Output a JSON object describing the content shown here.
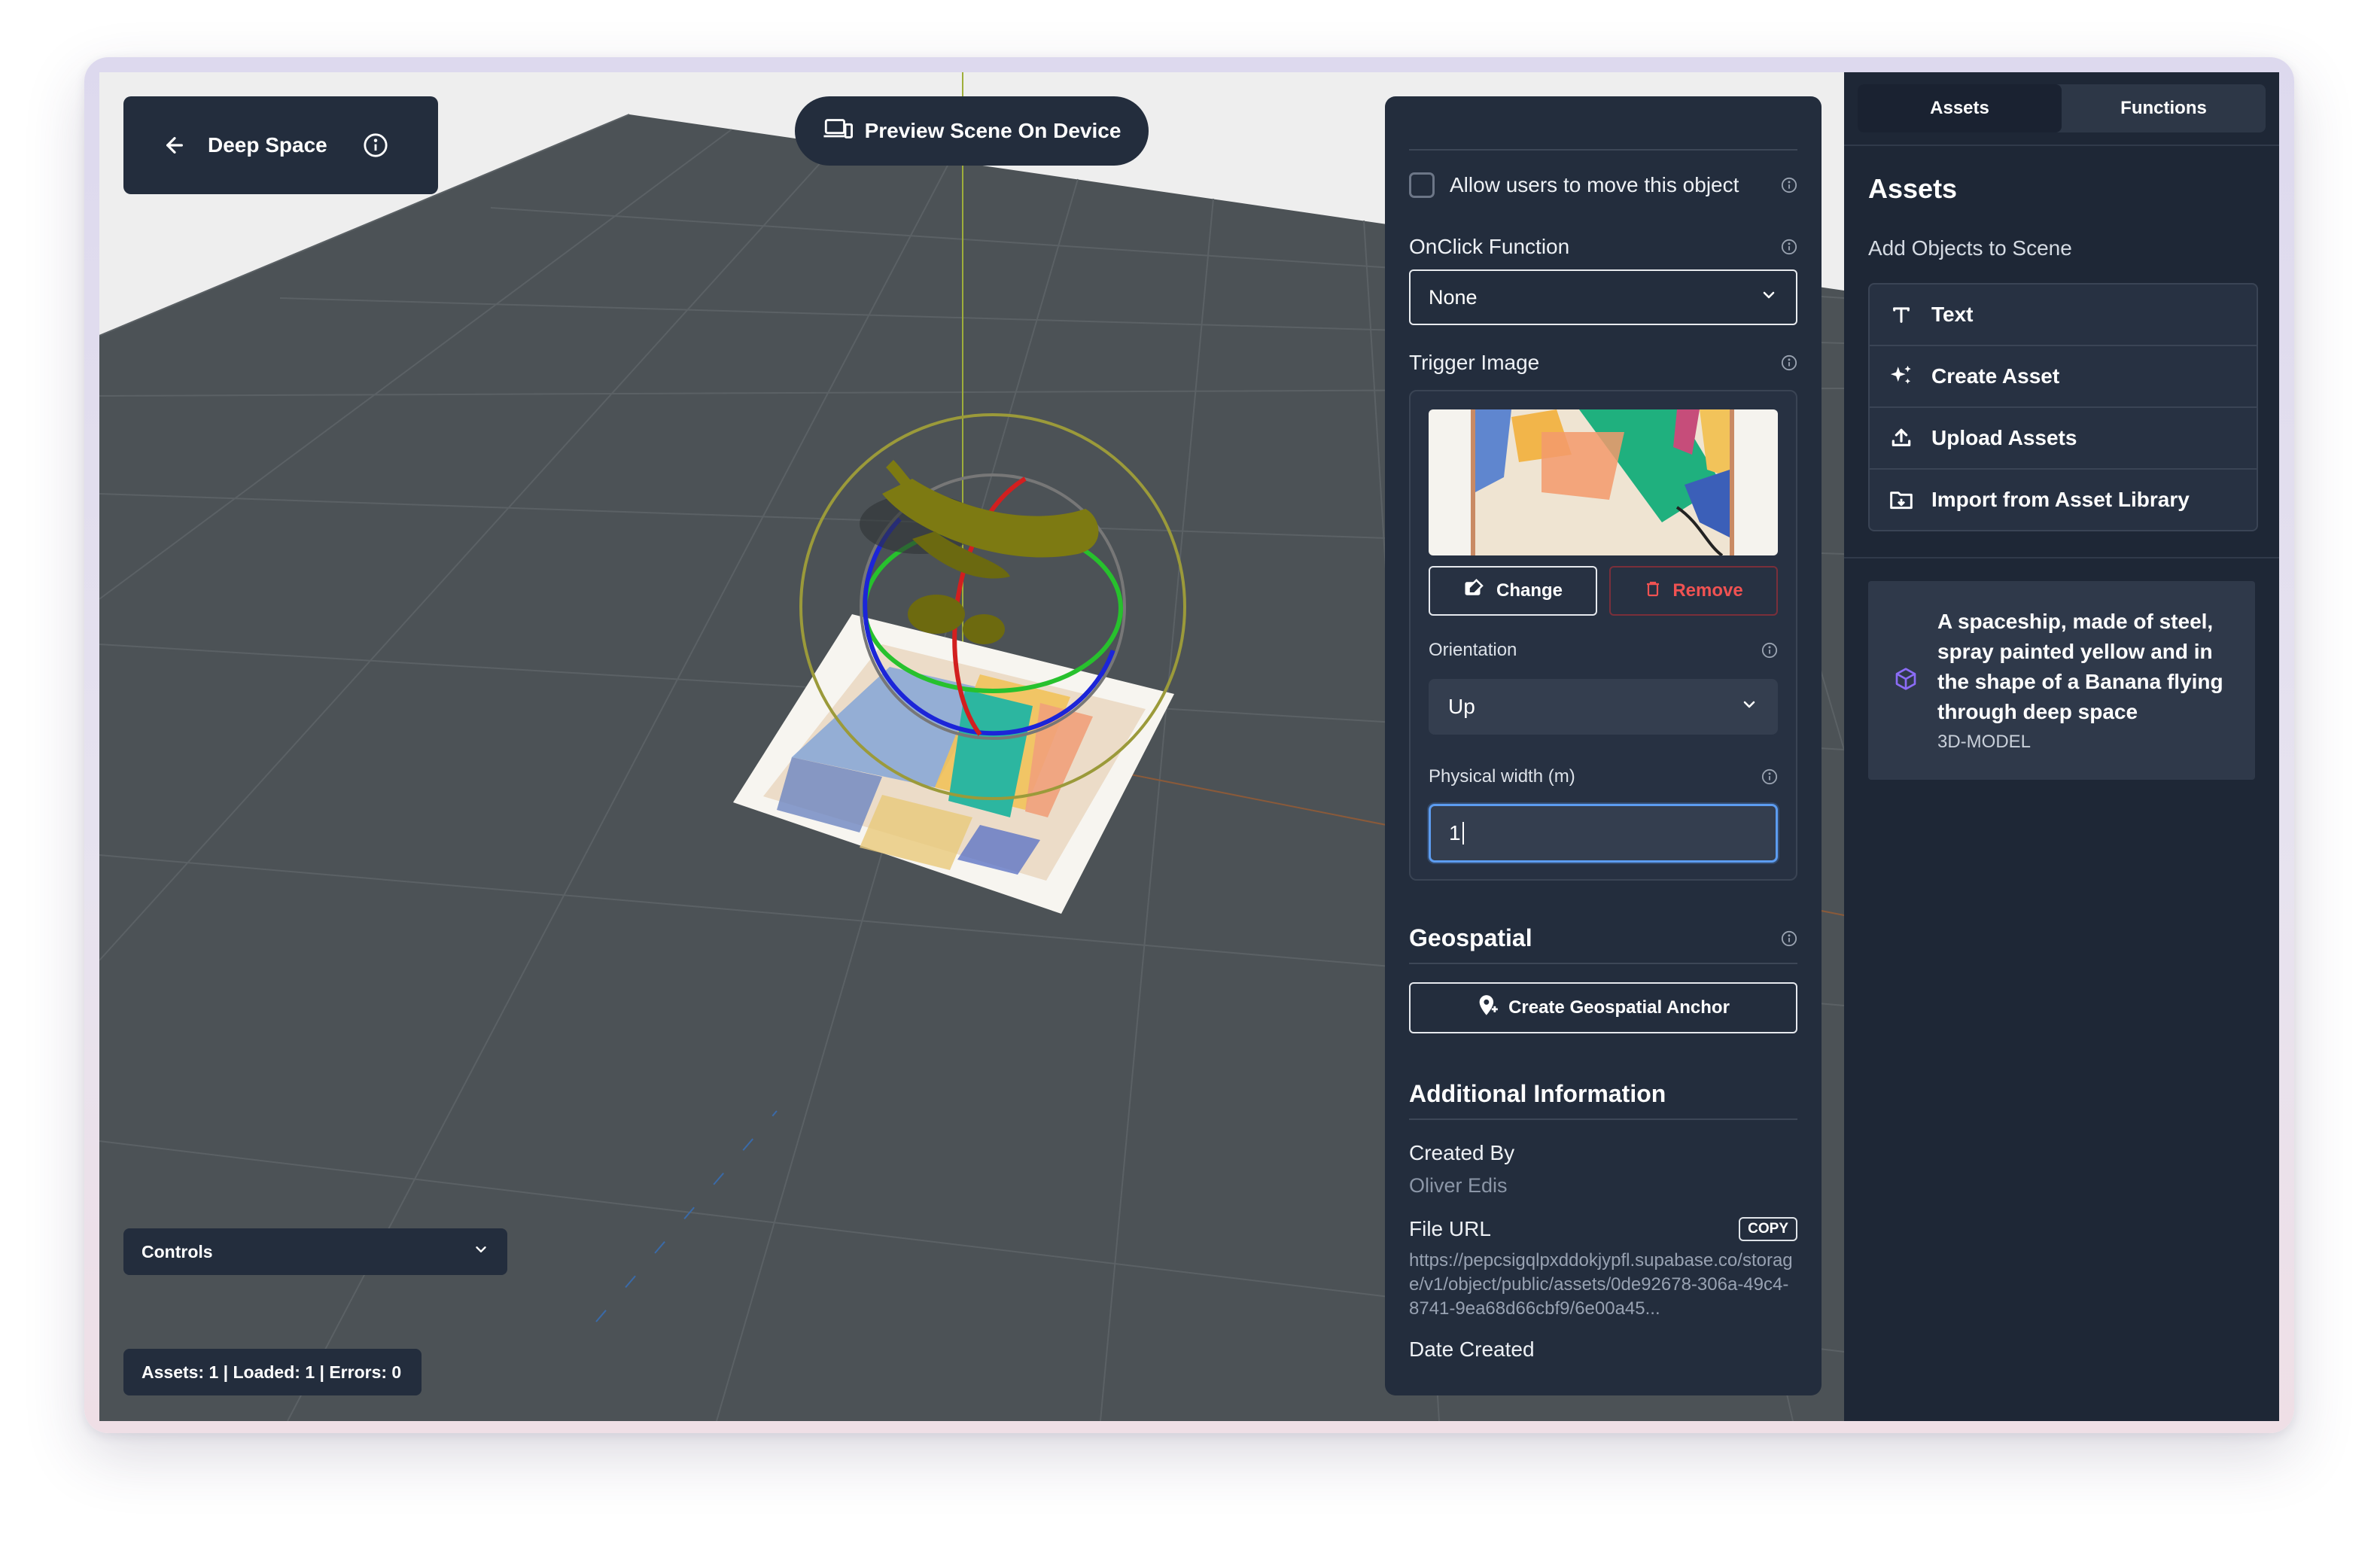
{
  "header": {
    "title": "Deep Space",
    "preview_label": "Preview Scene On Device"
  },
  "viewport": {
    "controls_label": "Controls",
    "stats": "Assets: 1 | Loaded: 1 | Errors: 0"
  },
  "inspector": {
    "allow_move_label": "Allow users to move this object",
    "allow_move_checked": false,
    "onclick_label": "OnClick Function",
    "onclick_value": "None",
    "trigger_label": "Trigger Image",
    "change_label": "Change",
    "remove_label": "Remove",
    "orientation_label": "Orientation",
    "orientation_value": "Up",
    "width_label": "Physical width (m)",
    "width_value": "1",
    "geo_title": "Geospatial",
    "geo_button": "Create Geospatial Anchor",
    "info_title": "Additional Information",
    "created_by_label": "Created By",
    "created_by_value": "Oliver Edis",
    "file_url_label": "File URL",
    "copy_label": "COPY",
    "file_url_value": "https://pepcsigqlpxddokjypfl.supabase.co/storage/v1/object/public/assets/0de92678-306a-49c4-8741-9ea68d66cbf9/6e00a45...",
    "date_created_label": "Date Created"
  },
  "sidebar": {
    "tabs": [
      {
        "label": "Assets",
        "active": true
      },
      {
        "label": "Functions",
        "active": false
      }
    ],
    "title": "Assets",
    "subtitle": "Add Objects to Scene",
    "menu": [
      {
        "label": "Text",
        "icon": "text-icon"
      },
      {
        "label": "Create Asset",
        "icon": "sparkle-icon"
      },
      {
        "label": "Upload Assets",
        "icon": "upload-icon"
      },
      {
        "label": "Import from Asset Library",
        "icon": "folder-import-icon"
      }
    ],
    "asset": {
      "description": "A spaceship, made of steel, spray painted yellow and in the shape of a Banana flying through deep space",
      "type": "3D-MODEL",
      "icon": "cube-icon"
    }
  },
  "colors": {
    "panel": "#232d3d",
    "sidebar": "#1e2736",
    "viewport": "#4c5256",
    "accent_blue": "#5c9cf0",
    "remove_red": "#f05252",
    "asset_icon": "#8b6cf6",
    "model": "#7d7a12"
  }
}
